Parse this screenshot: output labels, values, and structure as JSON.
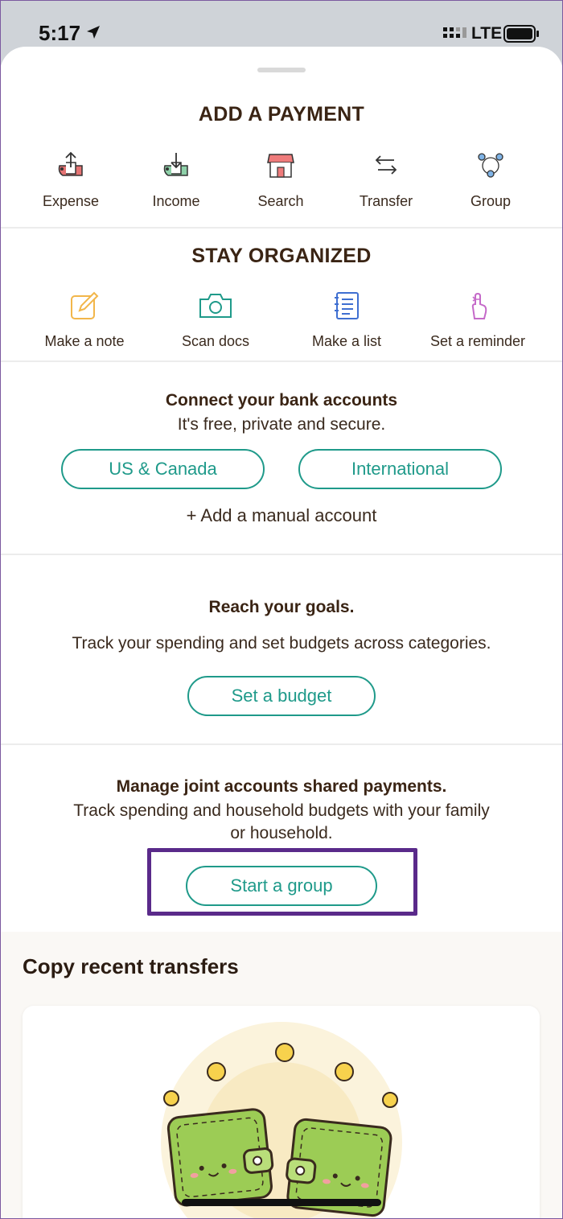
{
  "status_bar": {
    "time": "5:17",
    "network": "LTE"
  },
  "add_payment": {
    "title": "ADD A PAYMENT",
    "actions": [
      {
        "label": "Expense",
        "icon": "expense-upload-icon"
      },
      {
        "label": "Income",
        "icon": "income-download-icon"
      },
      {
        "label": "Search",
        "icon": "storefront-icon"
      },
      {
        "label": "Transfer",
        "icon": "transfer-arrows-icon"
      },
      {
        "label": "Group",
        "icon": "group-people-icon"
      }
    ]
  },
  "stay_organized": {
    "title": "STAY ORGANIZED",
    "actions": [
      {
        "label": "Make a note",
        "icon": "pencil-note-icon"
      },
      {
        "label": "Scan docs",
        "icon": "camera-icon"
      },
      {
        "label": "Make a list",
        "icon": "notebook-list-icon"
      },
      {
        "label": "Set a reminder",
        "icon": "finger-string-icon"
      }
    ]
  },
  "bank": {
    "title": "Connect your bank accounts",
    "subtitle": "It's free, private and secure.",
    "us_button": "US & Canada",
    "intl_button": "International",
    "manual_link": "+ Add a manual account"
  },
  "goals": {
    "title": "Reach your goals.",
    "subtitle": "Track your spending and set budgets across categories.",
    "button": "Set a budget"
  },
  "joint": {
    "title": "Manage joint accounts shared payments.",
    "line1": "Track spending and household budgets with your family",
    "line2": "or household.",
    "button": "Start a group"
  },
  "recent": {
    "title": "Copy recent transfers"
  },
  "colors": {
    "accent": "#1f9a8a",
    "highlight": "#5a2a8a",
    "heading": "#3a2414"
  }
}
